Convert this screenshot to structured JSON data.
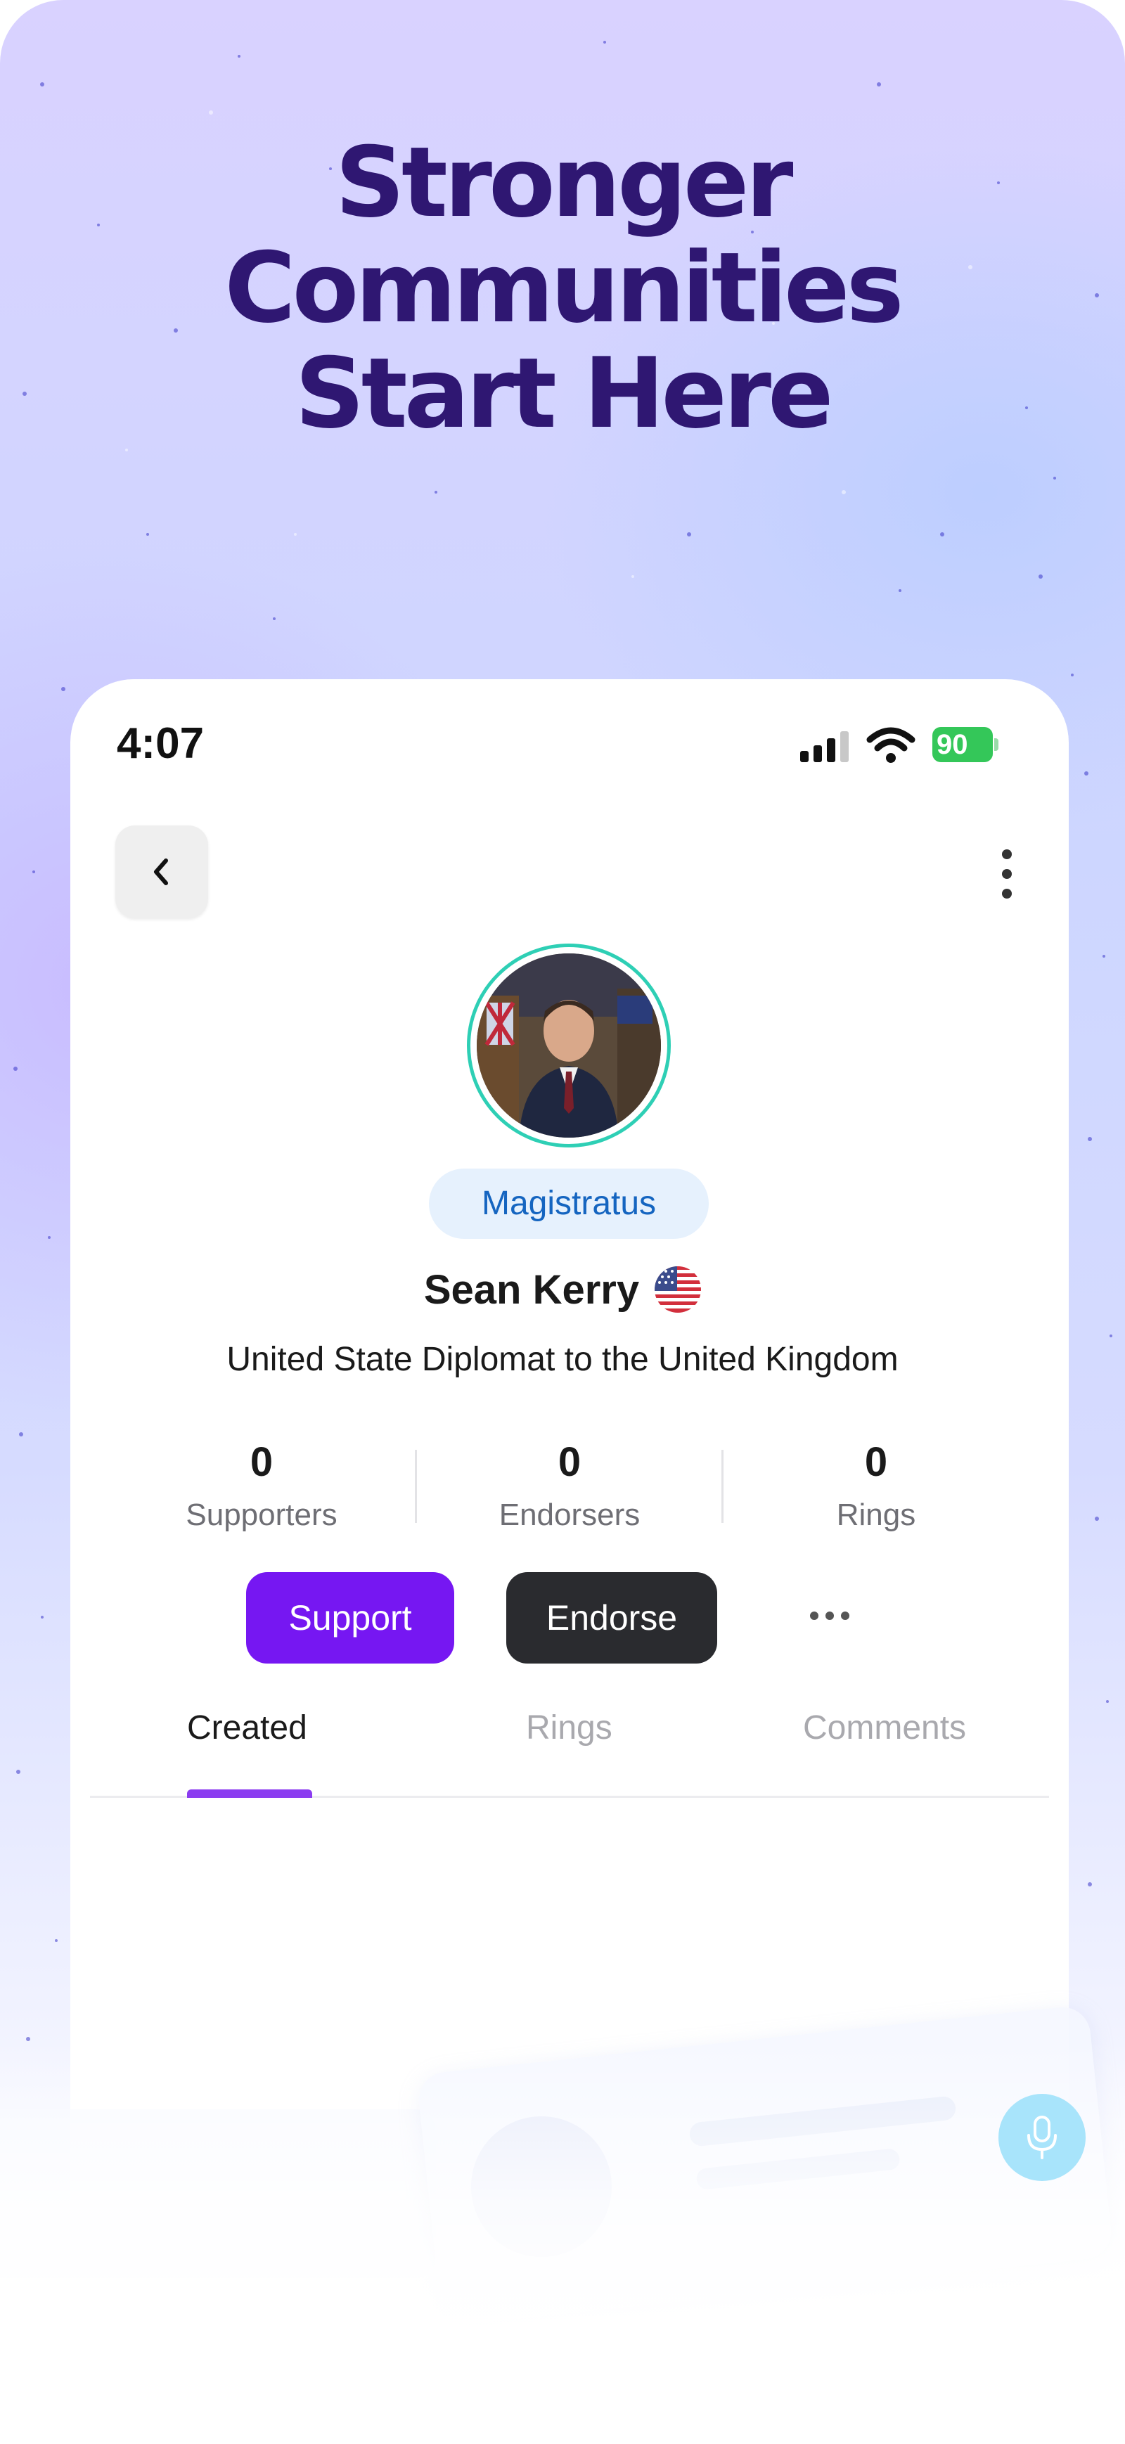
{
  "promo": {
    "headline_line1": "Stronger",
    "headline_line2": "Communities",
    "headline_line3": "Start Here"
  },
  "status_bar": {
    "time": "4:07",
    "battery": "90"
  },
  "profile": {
    "role_badge": "Magistratus",
    "name": "Sean Kerry",
    "flag_icon": "us-flag-icon",
    "bio": "United State Diplomat to the United Kingdom"
  },
  "stats": [
    {
      "value": "0",
      "label": "Supporters"
    },
    {
      "value": "0",
      "label": "Endorsers"
    },
    {
      "value": "0",
      "label": "Rings"
    }
  ],
  "actions": {
    "support_label": "Support",
    "endorse_label": "Endorse"
  },
  "tabs": [
    {
      "label": "Created",
      "active": true
    },
    {
      "label": "Rings",
      "active": false
    },
    {
      "label": "Comments",
      "active": false
    }
  ],
  "colors": {
    "headline": "#2f1772",
    "support_button": "#7617f2",
    "endorse_button": "#2a2b2f",
    "badge_text": "#1565c0",
    "tab_indicator": "#8b3cf0",
    "avatar_ring": "#2ecfb5",
    "mic_fab": "#a8e4fb"
  }
}
